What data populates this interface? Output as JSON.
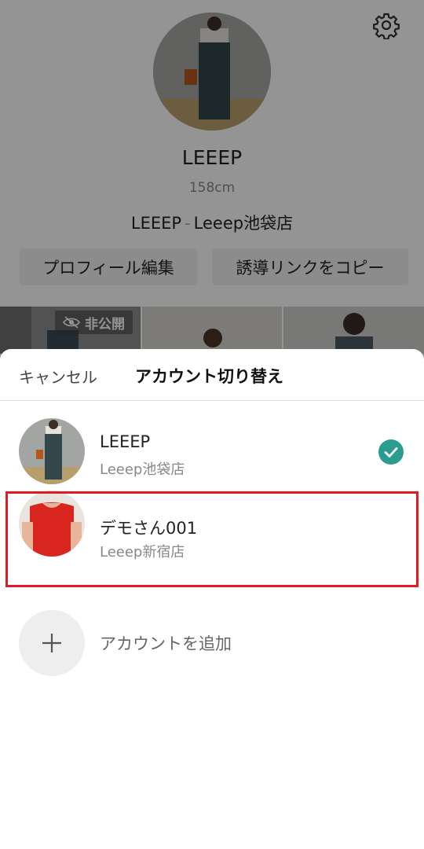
{
  "profile": {
    "name": "LEEEP",
    "height": "158cm",
    "shop_brand": "LEEEP",
    "shop_separator": "-",
    "shop_store": "Leeep池袋店",
    "edit_button": "プロフィール編集",
    "copy_link_button": "誘導リンクをコピー",
    "private_badge": "非公開"
  },
  "sheet": {
    "cancel": "キャンセル",
    "title": "アカウント切り替え",
    "accounts": [
      {
        "name": "LEEEP",
        "store": "Leeep池袋店",
        "selected": true
      },
      {
        "name": "デモさん001",
        "store": "Leeep新宿店",
        "selected": false
      }
    ],
    "add_account": "アカウントを追加"
  },
  "colors": {
    "check": "#2a9d8f",
    "highlight": "#e01b24",
    "overlay": "rgba(0,0,0,0.42)"
  },
  "icons": [
    "gear-icon",
    "eye-off-icon",
    "check-icon",
    "plus-icon"
  ]
}
